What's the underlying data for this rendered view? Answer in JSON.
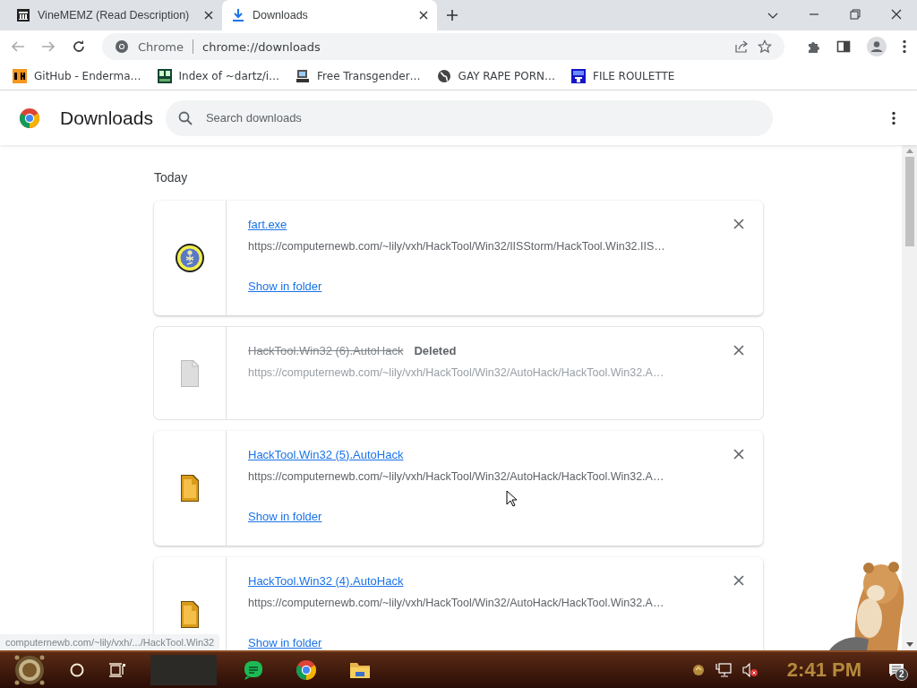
{
  "tabs": [
    {
      "title": "VineMEMZ (Read Description)",
      "selected": false
    },
    {
      "title": "Downloads",
      "selected": true
    }
  ],
  "omnibox": {
    "site_label": "Chrome",
    "url": "chrome://downloads"
  },
  "bookmarks": [
    {
      "label": "GitHub - Enderma…"
    },
    {
      "label": "Index of ~dartz/i…"
    },
    {
      "label": "Free Transgender…"
    },
    {
      "label": "GAY RAPE PORN…"
    },
    {
      "label": "FILE ROULETTE"
    }
  ],
  "page": {
    "title": "Downloads",
    "search_placeholder": "Search downloads",
    "section": "Today"
  },
  "downloads": [
    {
      "kind": "program",
      "name": "fart.exe",
      "url": "https://computernewb.com/~lily/vxh/HackTool/Win32/IISStorm/HackTool.Win32.IIS…",
      "action": "Show in folder"
    },
    {
      "kind": "deleted",
      "name": "HackTool.Win32 (6).AutoHack",
      "status": "Deleted",
      "url": "https://computernewb.com/~lily/vxh/HackTool/Win32/AutoHack/HackTool.Win32.A…"
    },
    {
      "kind": "file",
      "name": "HackTool.Win32 (5).AutoHack",
      "url": "https://computernewb.com/~lily/vxh/HackTool/Win32/AutoHack/HackTool.Win32.A…",
      "action": "Show in folder"
    },
    {
      "kind": "file",
      "name": "HackTool.Win32 (4).AutoHack",
      "url": "https://computernewb.com/~lily/vxh/HackTool/Win32/AutoHack/HackTool.Win32.A…",
      "action": "Show in folder"
    }
  ],
  "status_bubble": "computernewb.com/~lily/vxh/.../HackTool.Win32",
  "taskbar": {
    "clock": "2:41 PM",
    "notification_count": "2"
  }
}
